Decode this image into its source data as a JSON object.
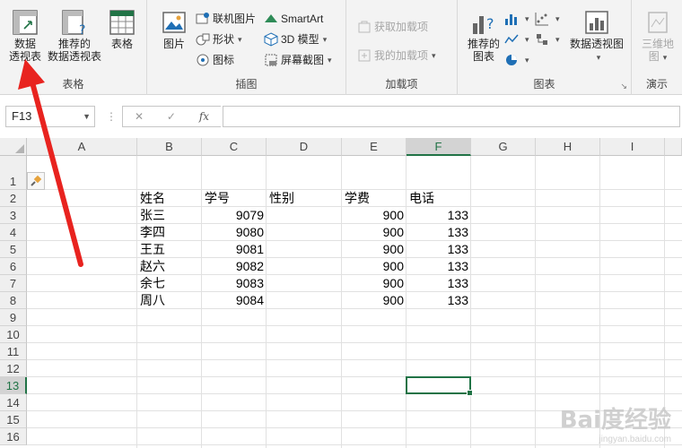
{
  "ribbon": {
    "groups": {
      "tables": {
        "label": "表格",
        "pivot": "数据\n透视表",
        "pivot_l1": "数据",
        "pivot_l2": "透视表",
        "rec_pivot_l1": "推荐的",
        "rec_pivot_l2": "数据透视表",
        "table": "表格"
      },
      "illustrations": {
        "label": "插图",
        "pictures": "图片",
        "online_pictures": "联机图片",
        "shapes": "形状",
        "icons": "图标",
        "smartart": "SmartArt",
        "model3d": "3D 模型",
        "screenshot": "屏幕截图"
      },
      "addins": {
        "label": "加载项",
        "get": "获取加载项",
        "my": "我的加载项"
      },
      "charts": {
        "label": "图表",
        "rec_l1": "推荐的",
        "rec_l2": "图表",
        "pivotchart": "数据透视图"
      },
      "tours": {
        "label": "演示",
        "map3d_l1": "三维地",
        "map3d_l2": "图"
      }
    }
  },
  "formula_bar": {
    "name_box": "F13",
    "fx": "fx",
    "formula": ""
  },
  "columns": [
    "A",
    "B",
    "C",
    "D",
    "E",
    "F",
    "G",
    "H",
    "I"
  ],
  "rows": [
    "1",
    "2",
    "3",
    "4",
    "5",
    "6",
    "7",
    "8",
    "9",
    "10",
    "11",
    "12",
    "13",
    "14",
    "15",
    "16"
  ],
  "table": {
    "headers": [
      "姓名",
      "学号",
      "性别",
      "学费",
      "电话"
    ],
    "rows": [
      [
        "张三",
        "9079",
        "",
        "900",
        "133"
      ],
      [
        "李四",
        "9080",
        "",
        "900",
        "133"
      ],
      [
        "王五",
        "9081",
        "",
        "900",
        "133"
      ],
      [
        "赵六",
        "9082",
        "",
        "900",
        "133"
      ],
      [
        "余七",
        "9083",
        "",
        "900",
        "133"
      ],
      [
        "周八",
        "9084",
        "",
        "900",
        "133"
      ]
    ]
  },
  "selected_cell": "F13",
  "watermark": {
    "brand": "Bai度经验",
    "url": "jingyan.baidu.com"
  },
  "colors": {
    "accent": "#217346",
    "annotation_arrow": "#e8231f"
  }
}
